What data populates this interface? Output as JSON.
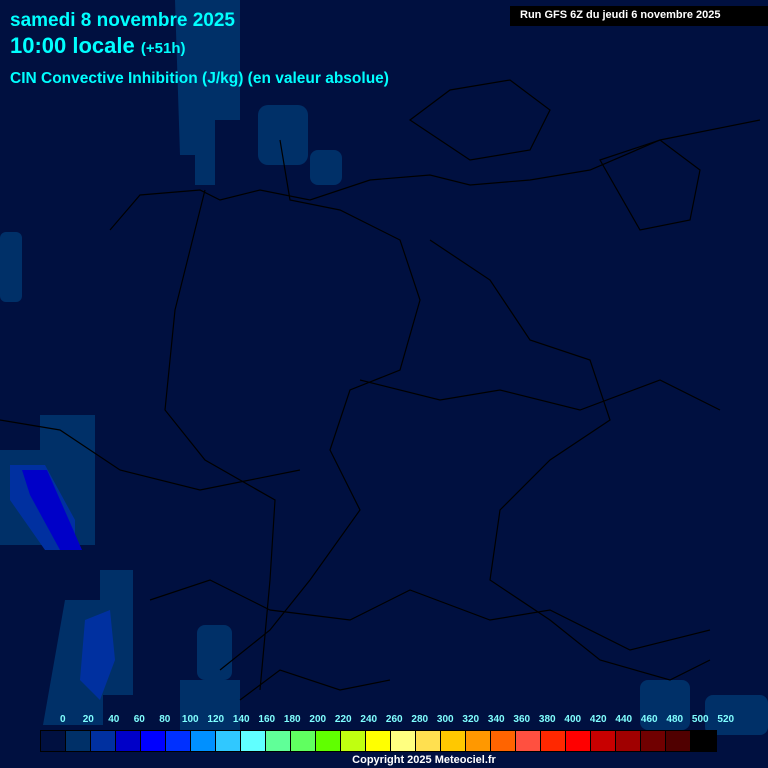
{
  "header": {
    "date": "samedi 8 novembre 2025",
    "time": "10:00 locale",
    "lead": "(+51h)",
    "parameter": "CIN Convective Inhibition (J/kg) (en valeur absolue)",
    "run": "Run GFS 6Z du jeudi 6 novembre 2025"
  },
  "legend": {
    "labels": [
      "0",
      "20",
      "40",
      "60",
      "80",
      "100",
      "120",
      "140",
      "160",
      "180",
      "200",
      "220",
      "240",
      "260",
      "280",
      "300",
      "320",
      "340",
      "360",
      "380",
      "400",
      "420",
      "440",
      "460",
      "480",
      "500",
      "520"
    ],
    "colors": [
      "#001040",
      "#003068",
      "#0030a0",
      "#0000c8",
      "#0000ff",
      "#0030ff",
      "#0090ff",
      "#30c8ff",
      "#60ffff",
      "#60ff98",
      "#60ff60",
      "#60ff00",
      "#c0ff10",
      "#ffff00",
      "#ffff80",
      "#ffe050",
      "#ffc800",
      "#ff9800",
      "#ff6400",
      "#ff5040",
      "#ff2800",
      "#ff0000",
      "#c80000",
      "#a00000",
      "#700000",
      "#500000",
      "#000000"
    ]
  },
  "footer": {
    "copyright": "Copyright 2025 Meteociel.fr"
  }
}
